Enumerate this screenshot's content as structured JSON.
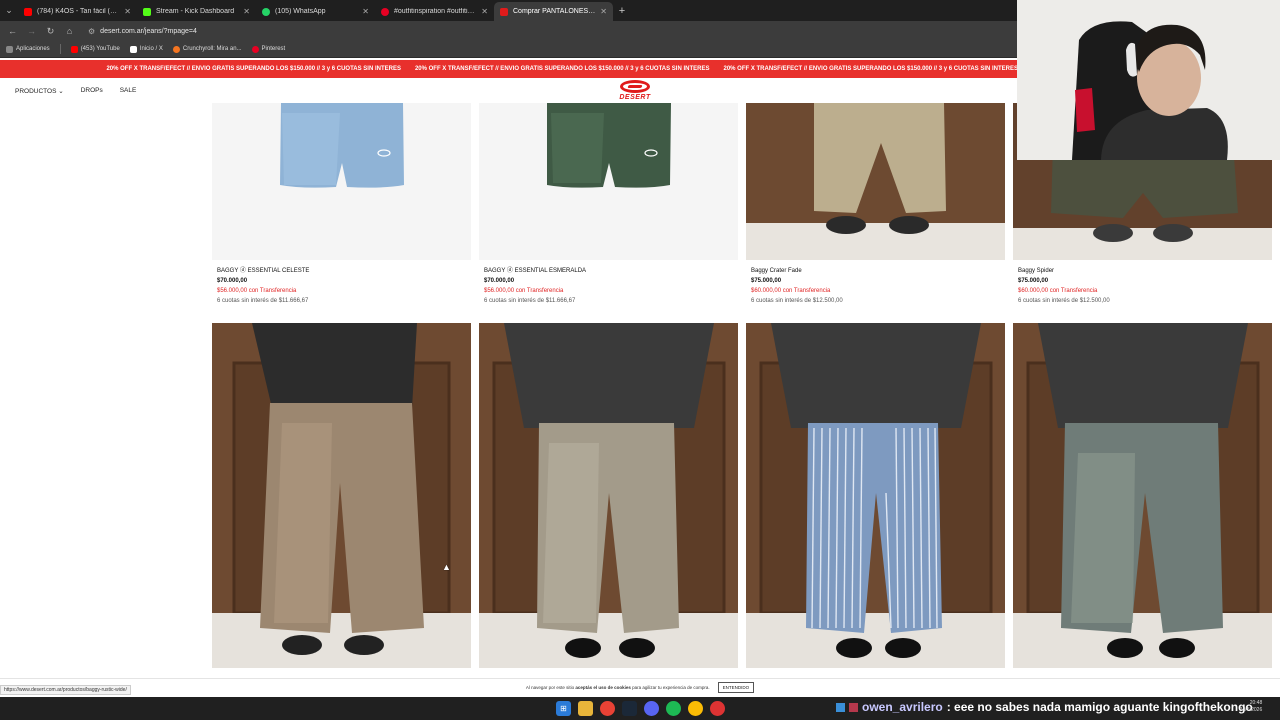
{
  "browser": {
    "tabs": [
      {
        "title": "(784) K4OS - Tan fácil (Vide",
        "color": "#ff0000",
        "active": false
      },
      {
        "title": "Stream - Kick Dashboard",
        "color": "#53fc18",
        "active": false
      },
      {
        "title": "(105) WhatsApp",
        "color": "#25d366",
        "active": false
      },
      {
        "title": "#outfitinspiration #outfitinspo",
        "color": "#e60023",
        "active": false
      },
      {
        "title": "Comprar PANTALONES en Des",
        "color": "#e01b1b",
        "active": true
      }
    ],
    "new_tab": "+",
    "url": "desert.com.ar/jeans/?mpage=4",
    "bookmarks": [
      {
        "label": "Aplicaciones",
        "color": "#888888"
      },
      {
        "label": "(453) YouTube",
        "color": "#ff0000"
      },
      {
        "label": "Inicio / X",
        "color": "#ffffff"
      },
      {
        "label": "Crunchyroll: Mira an...",
        "color": "#f47521"
      },
      {
        "label": "Pinterest",
        "color": "#e60023"
      }
    ]
  },
  "site": {
    "promo_text": "20% OFF X TRANSF/EFECT // ENVIO GRATIS SUPERANDO LOS $150.000 // 3 y 6 CUOTAS SIN INTERES",
    "nav": [
      "PRODUCTOS",
      "DROPs",
      "SALE"
    ],
    "logo": "DESERT",
    "products_top": [
      {
        "name": "BAGGY ⓓ ESSENTIAL CELESTE",
        "price": "$70.000,00",
        "transfer": "$56.000,00 con Transferencia",
        "cuotas": "6 cuotas sin interés de $11.666,67"
      },
      {
        "name": "BAGGY ⓓ ESSENTIAL ESMERALDA",
        "price": "$70.000,00",
        "transfer": "$56.000,00 con Transferencia",
        "cuotas": "6 cuotas sin interés de $11.666,67"
      },
      {
        "name": "Baggy Crater Fade",
        "price": "$75.000,00",
        "transfer": "$60.000,00 con Transferencia",
        "cuotas": "6 cuotas sin interés de $12.500,00"
      },
      {
        "name": "Baggy Spider",
        "price": "$75.000,00",
        "transfer": "$60.000,00 con Transferencia",
        "cuotas": "6 cuotas sin interés de $12.500,00"
      }
    ],
    "cookie_text_a": "Al navegar por este sitio ",
    "cookie_text_b": "aceptás el uso de cookies",
    "cookie_text_c": " para agilizar tu experiencia de compra.",
    "cookie_button": "ENTENDIDO",
    "status_url": "https://www.desert.com.ar/productos/baggy-rustic-wide/"
  },
  "stream": {
    "chat_user": "owen_avrilero",
    "chat_message": ": eee no sabes nada mamigo aguante kingofthekongo",
    "clock_time": "20:48",
    "clock_date": "19/5/2026"
  },
  "colors": {
    "accent": "#e8302c",
    "transfer": "#e02424"
  }
}
